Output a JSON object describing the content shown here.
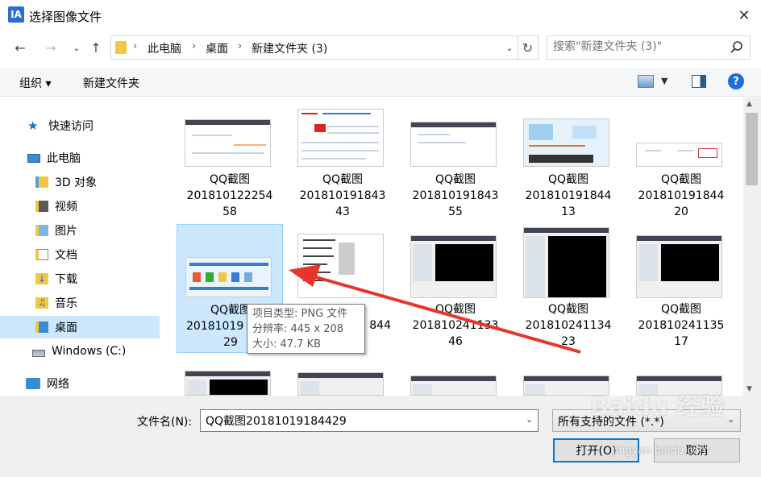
{
  "window": {
    "title": "选择图像文件",
    "app_icon": "IA",
    "close": "✕"
  },
  "address": {
    "crumbs": [
      "此电脑",
      "桌面",
      "新建文件夹 (3)"
    ],
    "search_placeholder": "搜索\"新建文件夹 (3)\""
  },
  "toolbar": {
    "organize": "组织 ▾",
    "new_folder": "新建文件夹",
    "help": "?"
  },
  "sidebar": {
    "items": [
      {
        "label": "快速访问",
        "icon": "star-icon"
      },
      {
        "label": "此电脑",
        "icon": "computer-icon"
      },
      {
        "label": "3D 对象",
        "icon": "3d-objects-icon"
      },
      {
        "label": "视频",
        "icon": "video-icon"
      },
      {
        "label": "图片",
        "icon": "pictures-icon"
      },
      {
        "label": "文档",
        "icon": "documents-icon"
      },
      {
        "label": "下载",
        "icon": "downloads-icon"
      },
      {
        "label": "音乐",
        "icon": "music-icon"
      },
      {
        "label": "桌面",
        "icon": "desktop-icon",
        "selected": true
      },
      {
        "label": "Windows (C:)",
        "icon": "drive-icon"
      },
      {
        "label": "网络",
        "icon": "network-icon"
      }
    ]
  },
  "files": [
    {
      "line1": "QQ截图",
      "line2": "201810122254",
      "line3": "58"
    },
    {
      "line1": "QQ截图",
      "line2": "201810191843",
      "line3": "43"
    },
    {
      "line1": "QQ截图",
      "line2": "201810191843",
      "line3": "55"
    },
    {
      "line1": "QQ截图",
      "line2": "201810191844",
      "line3": "13"
    },
    {
      "line1": "QQ截图",
      "line2": "201810191844",
      "line3": "20"
    },
    {
      "line1": "QQ截图",
      "line2": "20181019",
      "line3": "29",
      "selected": true
    },
    {
      "line1": "",
      "line2": "844",
      "line3": ""
    },
    {
      "line1": "QQ截图",
      "line2": "201810241133",
      "line3": "46"
    },
    {
      "line1": "QQ截图",
      "line2": "201810241134",
      "line3": "23"
    },
    {
      "line1": "QQ截图",
      "line2": "201810241135",
      "line3": "17"
    }
  ],
  "tooltip": {
    "type": "项目类型: PNG 文件",
    "resolution": "分辨率: 445 x 208",
    "size": "大小: 47.7 KB"
  },
  "bottom": {
    "filename_label": "文件名(N):",
    "filename_value": "QQ截图20181019184429",
    "filetype": "所有支持的文件 (*.*)",
    "open": "打开(O)",
    "cancel": "取消"
  },
  "watermark": {
    "main": "Baidu 经验",
    "sub": "jingyan.baidu.com"
  },
  "colors": {
    "selection": "#cce8ff",
    "accent": "#0078d7",
    "arrow": "#e8352a"
  }
}
